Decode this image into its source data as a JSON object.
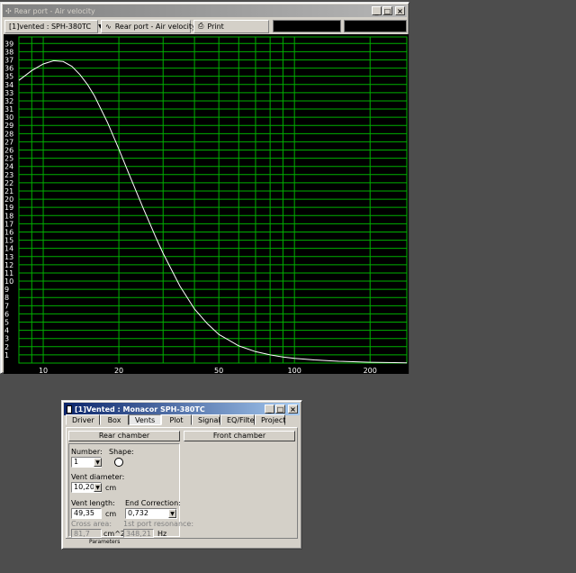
{
  "graph_window": {
    "title": "Rear port - Air velocity",
    "toolbar": {
      "project": "[1]vented : SPH-380TC",
      "graph": "Rear port - Air velocity",
      "print": "Print"
    }
  },
  "chart_data": {
    "type": "line",
    "title": "",
    "xlabel": "",
    "ylabel": "",
    "x_scale": "log",
    "xlim": [
      8,
      280
    ],
    "ylim": [
      0,
      39.8
    ],
    "x_ticks": [
      10,
      20,
      50,
      100,
      200
    ],
    "y_ticks": [
      1,
      2,
      3,
      4,
      5,
      6,
      7,
      8,
      9,
      10,
      11,
      12,
      13,
      14,
      15,
      16,
      17,
      18,
      19,
      20,
      21,
      22,
      23,
      24,
      25,
      26,
      27,
      28,
      29,
      30,
      31,
      32,
      33,
      34,
      35,
      36,
      37,
      38,
      39
    ],
    "grid": true,
    "colors": {
      "background": "#000000",
      "grid": "#00b000",
      "line": "#ffffff",
      "ticks": "#ffffff"
    },
    "series": [
      {
        "x": [
          8,
          9,
          10,
          11,
          12,
          13,
          14,
          15,
          16,
          18,
          20,
          22,
          25,
          28,
          30,
          35,
          40,
          45,
          50,
          60,
          70,
          80,
          90,
          100,
          120,
          150,
          200,
          250,
          280
        ],
        "y": [
          34.5,
          35.7,
          36.5,
          36.9,
          36.8,
          36.2,
          35.2,
          34.0,
          32.6,
          29.4,
          26.1,
          23.0,
          18.9,
          15.4,
          13.4,
          9.4,
          6.6,
          4.8,
          3.5,
          2.1,
          1.4,
          1.0,
          0.75,
          0.58,
          0.38,
          0.22,
          0.1,
          0.05,
          0.03
        ]
      }
    ]
  },
  "dialog": {
    "title": "[1]Vented : Monacor SPH-380TC",
    "tabs": [
      "Driver",
      "Box",
      "Vents",
      "Plot",
      "Signal",
      "EQ/Filter",
      "Project"
    ],
    "selected_tab": "Vents",
    "rear_chamber": "Rear chamber",
    "front_chamber": "Front chamber",
    "number_label": "Number:",
    "number_value": "1",
    "shape_label": "Shape:",
    "vent_diameter_label": "Vent diameter:",
    "vent_diameter_value": "10,20",
    "vent_diameter_unit": "cm",
    "vent_length_label": "Vent length:",
    "vent_length_value": "49,35",
    "vent_length_unit": "cm",
    "end_correction_label": "End Correction:",
    "end_correction_value": "0,732",
    "cross_area_label": "Cross area:",
    "cross_area_value": "81,7",
    "cross_area_unit": "cm^2",
    "port_resonance_label": "1st port resonance:",
    "port_resonance_value": "348,21",
    "port_resonance_unit": "Hz",
    "status": "Parameters"
  }
}
